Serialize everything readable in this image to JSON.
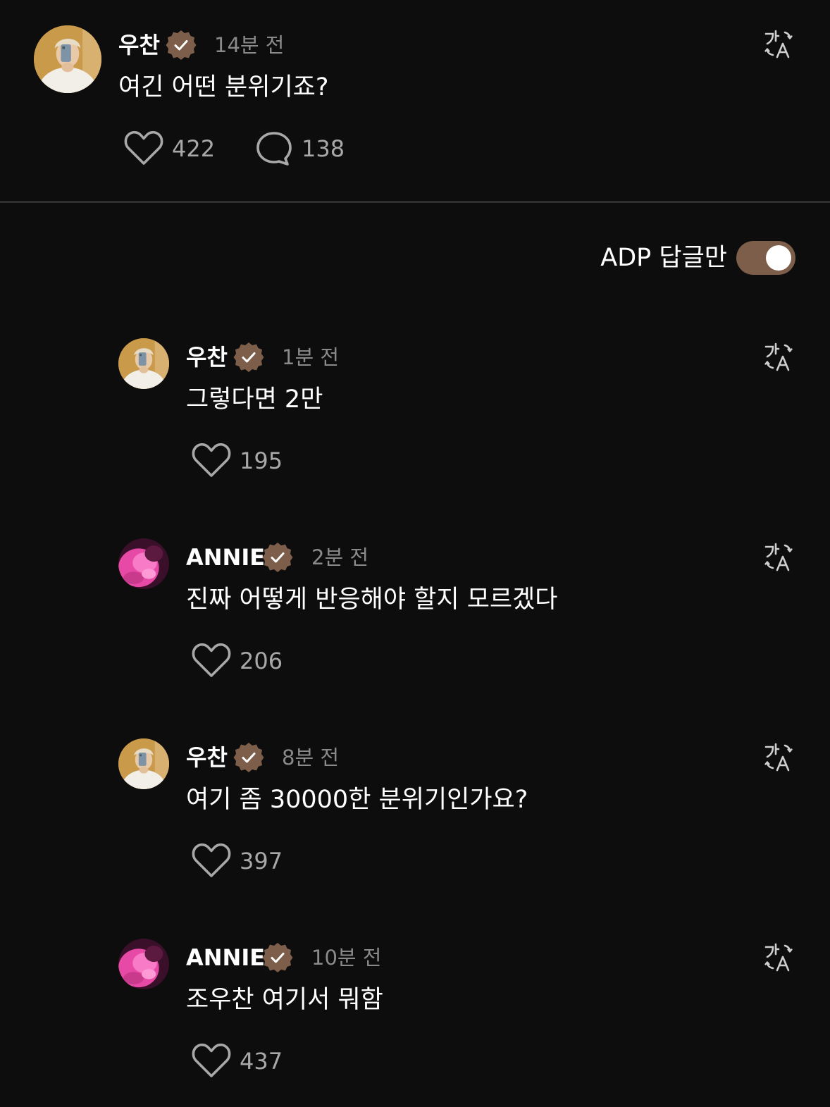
{
  "colors": {
    "accent": "#7d5e4a",
    "background": "#0d0d0d",
    "muted": "#8a8a8a"
  },
  "post": {
    "author": "우찬",
    "time": "14분 전",
    "text": "여긴 어떤 분위기죠?",
    "likes": "422",
    "comments": "138"
  },
  "filter": {
    "label": "ADP 답글만",
    "enabled": true
  },
  "replies": [
    {
      "author": "우찬",
      "time": "1분 전",
      "text": "그렇다면 2만",
      "likes": "195",
      "avatar": "photo-avatar"
    },
    {
      "author": "ANNIE",
      "time": "2분 전",
      "text": "진짜 어떻게 반응해야 할지 모르겠다",
      "likes": "206",
      "avatar": "pink-avatar"
    },
    {
      "author": "우찬",
      "time": "8분 전",
      "text": "여기 좀 30000한 분위기인가요?",
      "likes": "397",
      "avatar": "photo-avatar"
    },
    {
      "author": "ANNIE",
      "time": "10분 전",
      "text": "조우찬 여기서 뭐함",
      "likes": "437",
      "avatar": "pink-avatar"
    }
  ],
  "icons": {
    "translate": "translate-icon",
    "like": "heart-icon",
    "comment": "comment-icon",
    "verified": "verified-badge-icon"
  }
}
